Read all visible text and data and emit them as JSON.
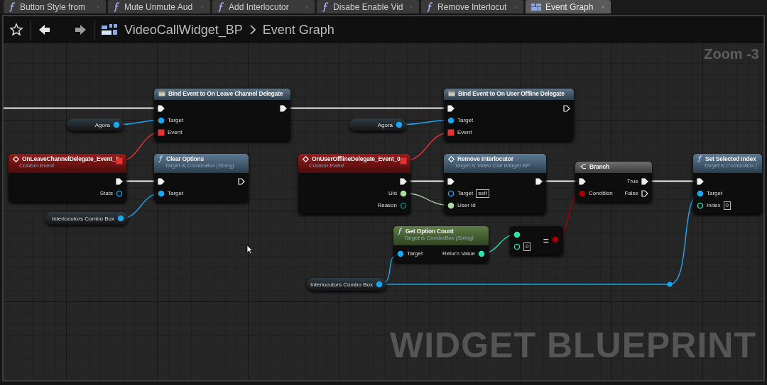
{
  "tabs": [
    {
      "label": "Button Style from",
      "selected": false,
      "kind": "function"
    },
    {
      "label": "Mute Unmute Aud",
      "selected": false,
      "kind": "function"
    },
    {
      "label": "Add Interlocutor",
      "selected": false,
      "kind": "function"
    },
    {
      "label": "Disabe Enable Vid",
      "selected": false,
      "kind": "function"
    },
    {
      "label": "Remove Interlocut",
      "selected": false,
      "kind": "function"
    },
    {
      "label": "Event Graph",
      "selected": true,
      "kind": "graph"
    }
  ],
  "breadcrumb": {
    "blueprint": "VideoCallWidget_BP",
    "graph": "Event Graph"
  },
  "zoom_label": "Zoom -3",
  "graph_caption": "WIDGET BLUEPRINT",
  "nodes": [
    {
      "kind": "bind",
      "title": "Bind Event to On Leave Channel Delegate",
      "rows": [
        {
          "left": {
            "kind": "exec",
            "connected": true
          },
          "right": {
            "kind": "exec",
            "connected": true
          }
        },
        {
          "left": {
            "kind": "object",
            "connected": true,
            "label": "Target"
          }
        },
        {
          "left": {
            "kind": "delegate",
            "connected": true,
            "label": "Event"
          }
        }
      ]
    },
    {
      "kind": "variable",
      "title": "Agora",
      "output": {
        "kind": "object",
        "connected": true
      }
    },
    {
      "kind": "event",
      "title": "OnLeaveChannelDelegate_Event_0",
      "subtitle": "Custom Event",
      "header_pin": {
        "kind": "delegate",
        "connected": true
      },
      "rows": [
        {
          "right": {
            "kind": "exec",
            "connected": true
          }
        },
        {
          "right": {
            "kind": "object",
            "connected": false,
            "label": "Stats"
          }
        }
      ]
    },
    {
      "kind": "function_call",
      "title": "Clear Options",
      "subtitle": "Target is ComboBox (String)",
      "rows": [
        {
          "left": {
            "kind": "exec",
            "connected": true
          },
          "right": {
            "kind": "exec",
            "connected": false
          }
        },
        {
          "left": {
            "kind": "object",
            "connected": true,
            "label": "Target"
          }
        }
      ]
    },
    {
      "kind": "variable",
      "title": "Interlocutors Combo Box",
      "output": {
        "kind": "object",
        "connected": true
      }
    },
    {
      "kind": "bind",
      "title": "Bind Event to On User Offline Delegate",
      "rows": [
        {
          "left": {
            "kind": "exec",
            "connected": true
          },
          "right": {
            "kind": "exec",
            "connected": false
          }
        },
        {
          "left": {
            "kind": "object",
            "connected": true,
            "label": "Target"
          }
        },
        {
          "left": {
            "kind": "delegate",
            "connected": true,
            "label": "Event"
          }
        }
      ]
    },
    {
      "kind": "variable",
      "title": "Agora",
      "output": {
        "kind": "object",
        "connected": true
      }
    },
    {
      "kind": "event",
      "title": "OnUserOfflineDelegate_Event_0",
      "subtitle": "Custom Event",
      "header_pin": {
        "kind": "delegate",
        "connected": true
      },
      "rows": [
        {
          "right": {
            "kind": "exec",
            "connected": true
          }
        },
        {
          "right": {
            "kind": "int64",
            "connected": true,
            "label": "Uid"
          }
        },
        {
          "right": {
            "kind": "byte",
            "connected": false,
            "label": "Reason"
          }
        }
      ]
    },
    {
      "kind": "event_call",
      "title": "Remove Interlocutor",
      "subtitle": "Target is Video Call Widget BP",
      "rows": [
        {
          "left": {
            "kind": "exec",
            "connected": true
          },
          "right": {
            "kind": "exec",
            "connected": true
          }
        },
        {
          "left": {
            "kind": "object",
            "connected": false,
            "label": "Target",
            "value": "self"
          }
        },
        {
          "left": {
            "kind": "int64",
            "connected": true,
            "label": "User Id"
          }
        }
      ]
    },
    {
      "kind": "branch",
      "title": "Branch",
      "rows": [
        {
          "left": {
            "kind": "exec",
            "connected": true
          },
          "right": {
            "kind": "exec",
            "connected": true,
            "label": "True"
          }
        },
        {
          "left": {
            "kind": "bool",
            "connected": true,
            "label": "Condition"
          },
          "right": {
            "kind": "exec",
            "connected": false,
            "label": "False"
          }
        }
      ]
    },
    {
      "kind": "function_call",
      "title": "Set Selected Index",
      "subtitle": "Target is ComboBox (",
      "rows": [
        {
          "left": {
            "kind": "exec",
            "connected": true
          }
        },
        {
          "left": {
            "kind": "object",
            "connected": true,
            "label": "Target"
          }
        },
        {
          "left": {
            "kind": "int",
            "connected": false,
            "label": "Index",
            "value": "0"
          }
        }
      ]
    },
    {
      "kind": "pure_function",
      "title": "Get Option Count",
      "subtitle": "Target is ComboBox (String)",
      "rows": [
        {
          "left": {
            "kind": "object",
            "connected": true,
            "label": "Target"
          },
          "right": {
            "kind": "int",
            "connected": true,
            "label": "Return Value"
          }
        }
      ]
    },
    {
      "kind": "compare",
      "symbol": "=",
      "rows": [
        {
          "left": {
            "kind": "int",
            "connected": true
          }
        },
        {
          "left": {
            "kind": "int",
            "connected": false,
            "value": "0"
          }
        }
      ],
      "output": {
        "kind": "bool",
        "connected": true
      }
    },
    {
      "kind": "variable",
      "title": "Interlocutors Combo Box",
      "output": {
        "kind": "object",
        "connected": true
      }
    }
  ]
}
